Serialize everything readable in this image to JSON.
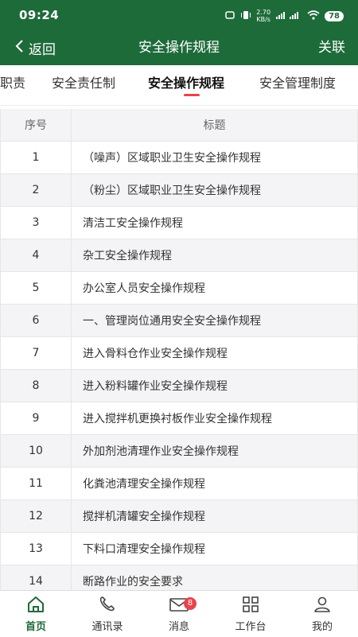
{
  "status_bar": {
    "time": "09:24",
    "speed": "2.70",
    "speed_unit": "KB/s",
    "battery": "78"
  },
  "navbar": {
    "back_label": "返回",
    "title": "安全操作规程",
    "action_label": "关联"
  },
  "tabs": [
    {
      "label": "职责"
    },
    {
      "label": "安全责任制"
    },
    {
      "label": "安全操作规程"
    },
    {
      "label": "安全管理制度"
    }
  ],
  "table": {
    "headers": {
      "num": "序号",
      "title": "标题"
    },
    "rows": [
      {
        "num": "1",
        "title": "（噪声）区域职业卫生安全操作规程"
      },
      {
        "num": "2",
        "title": "（粉尘）区域职业卫生安全操作规程"
      },
      {
        "num": "3",
        "title": "清洁工安全操作规程"
      },
      {
        "num": "4",
        "title": "杂工安全操作规程"
      },
      {
        "num": "5",
        "title": "办公室人员安全操作规程"
      },
      {
        "num": "6",
        "title": "一、管理岗位通用安全安全操作规程"
      },
      {
        "num": "7",
        "title": "进入骨料仓作业安全操作规程"
      },
      {
        "num": "8",
        "title": "进入粉料罐作业安全操作规程"
      },
      {
        "num": "9",
        "title": "进入搅拌机更换衬板作业安全操作规程"
      },
      {
        "num": "10",
        "title": "外加剂池清理作业安全操作规程"
      },
      {
        "num": "11",
        "title": "化粪池清理安全操作规程"
      },
      {
        "num": "12",
        "title": "搅拌机清罐安全操作规程"
      },
      {
        "num": "13",
        "title": "下料口清理安全操作规程"
      },
      {
        "num": "14",
        "title": "断路作业的安全要求"
      },
      {
        "num": "",
        "title": ""
      }
    ]
  },
  "bottom_nav": [
    {
      "label": "首页",
      "icon": "home-icon"
    },
    {
      "label": "通讯录",
      "icon": "phone-icon"
    },
    {
      "label": "消息",
      "icon": "mail-icon",
      "badge": "8"
    },
    {
      "label": "工作台",
      "icon": "grid-icon"
    },
    {
      "label": "我的",
      "icon": "user-icon"
    }
  ],
  "colors": {
    "brand": "#1e6b3a",
    "accent": "#e8434b"
  }
}
